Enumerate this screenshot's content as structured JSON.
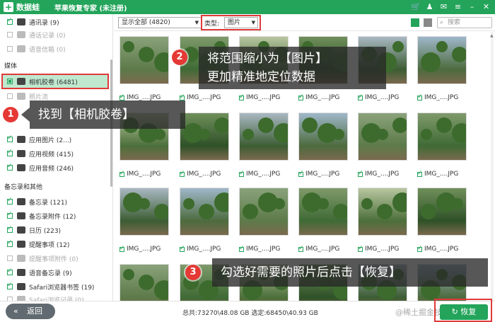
{
  "app": {
    "logo_text": "数据蛙",
    "title": "苹果恢复专家 (未注册)"
  },
  "sidebar": {
    "items_top": [
      {
        "label": "通讯录 (9)",
        "checked": true,
        "dim": false
      },
      {
        "label": "通话记录 (0)",
        "checked": false,
        "dim": true
      },
      {
        "label": "语音信箱 (0)",
        "checked": false,
        "dim": true
      }
    ],
    "media_heading": "媒体",
    "media_items": [
      {
        "label": "相机胶卷 (6481)",
        "checked": true,
        "dim": false
      },
      {
        "label": "照片流",
        "checked": false,
        "dim": true
      },
      {
        "label": "",
        "checked": false,
        "dim": true
      },
      {
        "label": "应用图片 (2...)",
        "checked": true,
        "dim": false
      },
      {
        "label": "应用视频 (415)",
        "checked": true,
        "dim": false
      },
      {
        "label": "应用音频 (246)",
        "checked": true,
        "dim": false
      }
    ],
    "memo_heading": "备忘录和其他",
    "memo_items": [
      {
        "label": "备忘录 (121)",
        "checked": true,
        "dim": false
      },
      {
        "label": "备忘录附件 (12)",
        "checked": true,
        "dim": false
      },
      {
        "label": "日历 (223)",
        "checked": true,
        "dim": false
      },
      {
        "label": "提醒事项 (12)",
        "checked": true,
        "dim": false
      },
      {
        "label": "提醒事项附件 (0)",
        "checked": false,
        "dim": true
      },
      {
        "label": "语音备忘录 (9)",
        "checked": true,
        "dim": false
      },
      {
        "label": "Safari浏览器书签 (19)",
        "checked": true,
        "dim": false
      },
      {
        "label": "Safari浏览记录 (0)",
        "checked": false,
        "dim": true
      }
    ]
  },
  "toolbar": {
    "filter_value": "显示全部 (4820)",
    "type_label": "类型:",
    "type_value": "图片",
    "search_placeholder": "搜索"
  },
  "grid": {
    "caption": "IMG_....JPG"
  },
  "annotations": {
    "step1_number": "1",
    "step1_text": "找到【相机胶卷】",
    "step2_number": "2",
    "step2_line1": "将范围缩小为【图片】",
    "step2_line2": "更加精准地定位数据",
    "step3_number": "3",
    "step3_text": "勾选好需要的照片后点击【恢复】"
  },
  "footer": {
    "back_label": "返回",
    "summary": "总共:73270\\48.08 GB 选定:68450\\40.93 GB",
    "watermark": "@稀土掘金技术社区",
    "recover_label": "恢复"
  },
  "colors": {
    "brand_green": "#23a45a",
    "highlight_red": "#e03a3a",
    "selected_bg": "#bfe8cf"
  }
}
